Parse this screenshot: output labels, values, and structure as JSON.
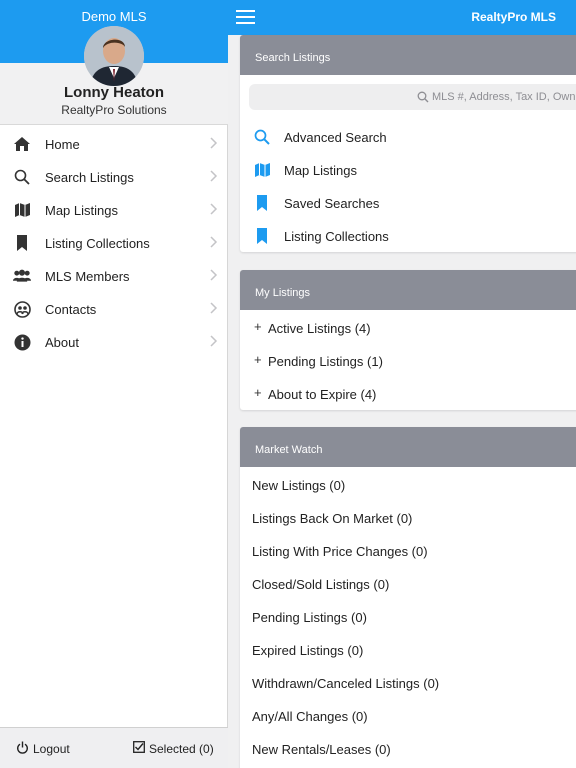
{
  "drawer": {
    "title": "Demo MLS",
    "user_name": "Lonny Heaton",
    "user_company": "RealtyPro Solutions",
    "nav": [
      {
        "label": "Home",
        "icon": "home-icon"
      },
      {
        "label": "Search Listings",
        "icon": "search-icon"
      },
      {
        "label": "Map Listings",
        "icon": "map-icon"
      },
      {
        "label": "Listing Collections",
        "icon": "bookmark-icon"
      },
      {
        "label": "MLS Members",
        "icon": "members-icon"
      },
      {
        "label": "Contacts",
        "icon": "contacts-icon"
      },
      {
        "label": "About",
        "icon": "info-icon"
      }
    ],
    "footer": {
      "logout": "Logout",
      "selected": "Selected (0)"
    }
  },
  "topbar": {
    "title": "RealtyPro MLS"
  },
  "search_card": {
    "header": "Search Listings",
    "placeholder": "MLS #, Address, Tax ID, Owne",
    "items": [
      {
        "label": "Advanced Search",
        "icon": "search-icon"
      },
      {
        "label": "Map Listings",
        "icon": "map-icon"
      },
      {
        "label": "Saved Searches",
        "icon": "bookmark-icon"
      },
      {
        "label": "Listing Collections",
        "icon": "bookmark-icon"
      }
    ]
  },
  "my_listings": {
    "header": "My Listings",
    "items": [
      {
        "label": "Active Listings (4)"
      },
      {
        "label": "Pending Listings (1)"
      },
      {
        "label": "About to Expire (4)"
      }
    ]
  },
  "market_watch": {
    "header": "Market Watch",
    "items": [
      {
        "label": "New Listings (0)"
      },
      {
        "label": "Listings Back On Market (0)"
      },
      {
        "label": "Listing With Price Changes (0)"
      },
      {
        "label": "Closed/Sold Listings (0)"
      },
      {
        "label": "Pending Listings (0)"
      },
      {
        "label": "Expired Listings (0)"
      },
      {
        "label": "Withdrawn/Canceled Listings (0)"
      },
      {
        "label": "Any/All Changes (0)"
      },
      {
        "label": "New Rentals/Leases (0)"
      }
    ]
  },
  "colors": {
    "accent": "#1d9bf0",
    "card_header": "#8a8d97",
    "icon_blue": "#1d9bf0"
  }
}
